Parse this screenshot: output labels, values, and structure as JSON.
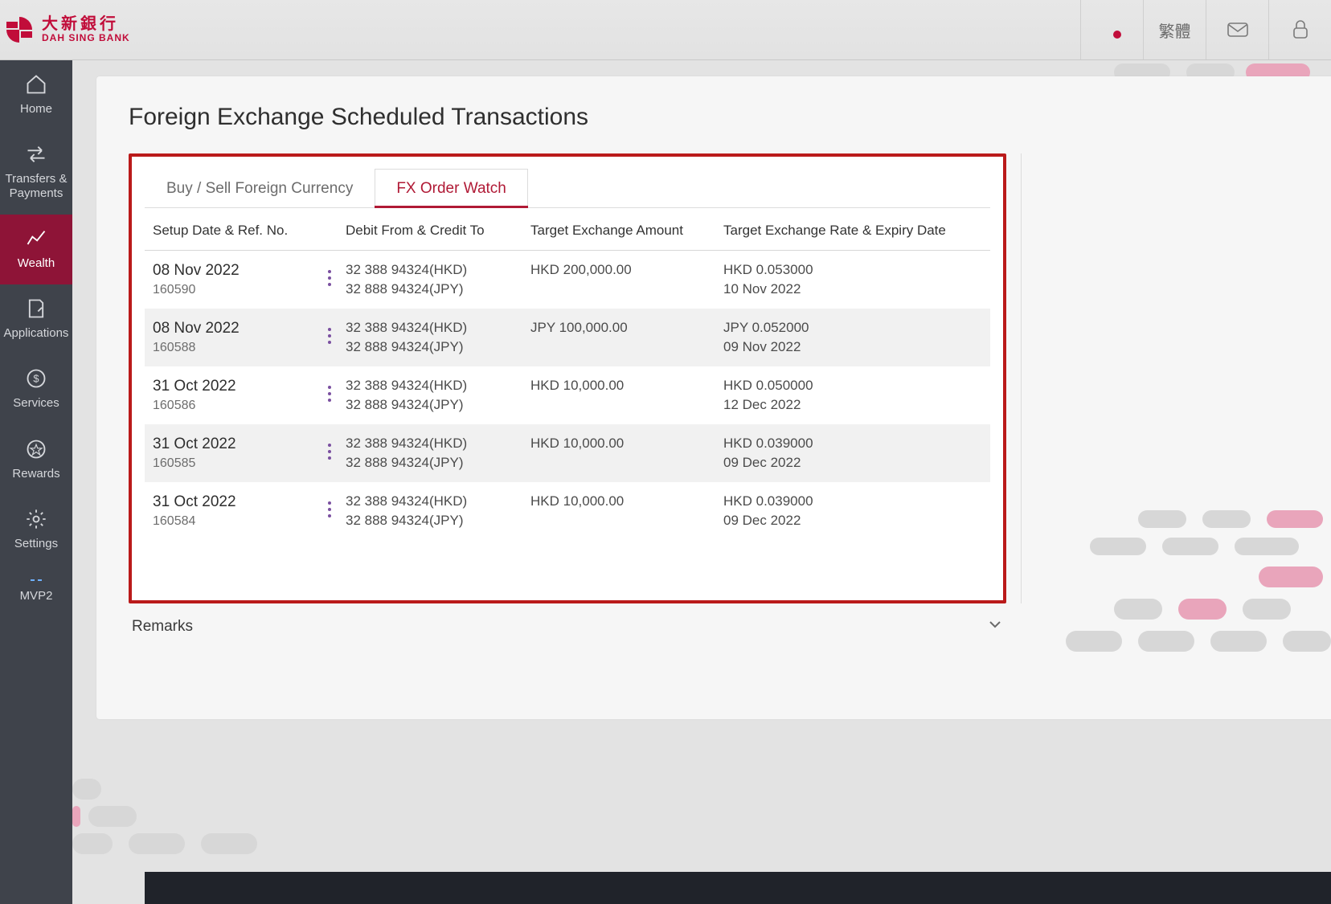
{
  "brand": {
    "cn": "大新銀行",
    "en": "DAH SING BANK"
  },
  "header": {
    "lang_label": "繁體"
  },
  "sidebar": {
    "items": [
      {
        "label": "Home"
      },
      {
        "label": "Transfers & Payments"
      },
      {
        "label": "Wealth"
      },
      {
        "label": "Applications"
      },
      {
        "label": "Services"
      },
      {
        "label": "Rewards"
      },
      {
        "label": "Settings"
      },
      {
        "label": "MVP2"
      }
    ]
  },
  "page": {
    "title": "Foreign Exchange Scheduled Transactions",
    "tabs": [
      {
        "label": "Buy / Sell Foreign Currency",
        "active": false
      },
      {
        "label": "FX Order Watch",
        "active": true
      }
    ],
    "columns": {
      "c1": "Setup Date & Ref. No.",
      "c2": "Debit From & Credit To",
      "c3": "Target Exchange Amount",
      "c4": "Target Exchange Rate & Expiry Date"
    },
    "rows": [
      {
        "date": "08 Nov 2022",
        "ref": "160590",
        "debit": "32 388 94324(HKD)",
        "credit": "32 888 94324(JPY)",
        "amount": "HKD 200,000.00",
        "rate": "HKD 0.053000",
        "expiry": "10 Nov 2022"
      },
      {
        "date": "08 Nov 2022",
        "ref": "160588",
        "debit": "32 388 94324(HKD)",
        "credit": "32 888 94324(JPY)",
        "amount": "JPY 100,000.00",
        "rate": "JPY 0.052000",
        "expiry": "09 Nov 2022"
      },
      {
        "date": "31 Oct 2022",
        "ref": "160586",
        "debit": "32 388 94324(HKD)",
        "credit": "32 888 94324(JPY)",
        "amount": "HKD 10,000.00",
        "rate": "HKD 0.050000",
        "expiry": "12 Dec 2022"
      },
      {
        "date": "31 Oct 2022",
        "ref": "160585",
        "debit": "32 388 94324(HKD)",
        "credit": "32 888 94324(JPY)",
        "amount": "HKD 10,000.00",
        "rate": "HKD 0.039000",
        "expiry": "09 Dec 2022"
      },
      {
        "date": "31 Oct 2022",
        "ref": "160584",
        "debit": "32 388 94324(HKD)",
        "credit": "32 888 94324(JPY)",
        "amount": "HKD 10,000.00",
        "rate": "HKD 0.039000",
        "expiry": "09 Dec 2022"
      }
    ],
    "remarks_label": "Remarks"
  },
  "colors": {
    "brand": "#b01935",
    "sidebar": "#3f434b",
    "highlight_border": "#ba1a1a"
  }
}
